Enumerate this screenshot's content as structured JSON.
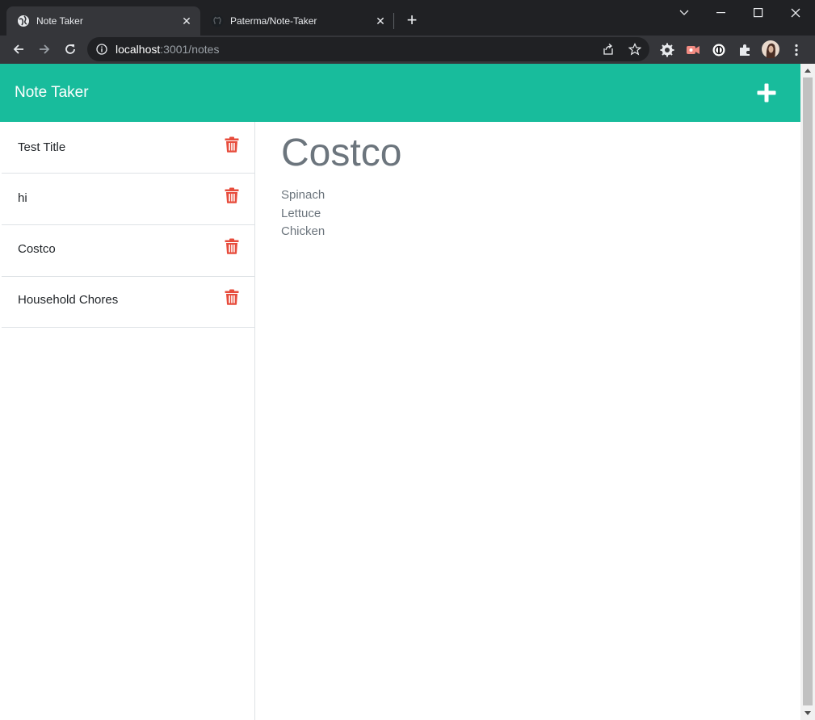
{
  "browser": {
    "tabs": [
      {
        "title": "Note Taker",
        "icon": "globe-icon",
        "active": true
      },
      {
        "title": "Paterma/Note-Taker",
        "icon": "github-icon",
        "active": false
      }
    ],
    "address": {
      "host": "localhost",
      "path": ":3001/notes"
    }
  },
  "app": {
    "brand": "Note Taker",
    "accent_color": "#18bc9c",
    "delete_color": "#e74c3c"
  },
  "notes": [
    {
      "title": "Test Title"
    },
    {
      "title": "hi"
    },
    {
      "title": "Costco"
    },
    {
      "title": "Household Chores"
    }
  ],
  "active_note": {
    "title": "Costco",
    "text": "Spinach\nLettuce\nChicken"
  }
}
